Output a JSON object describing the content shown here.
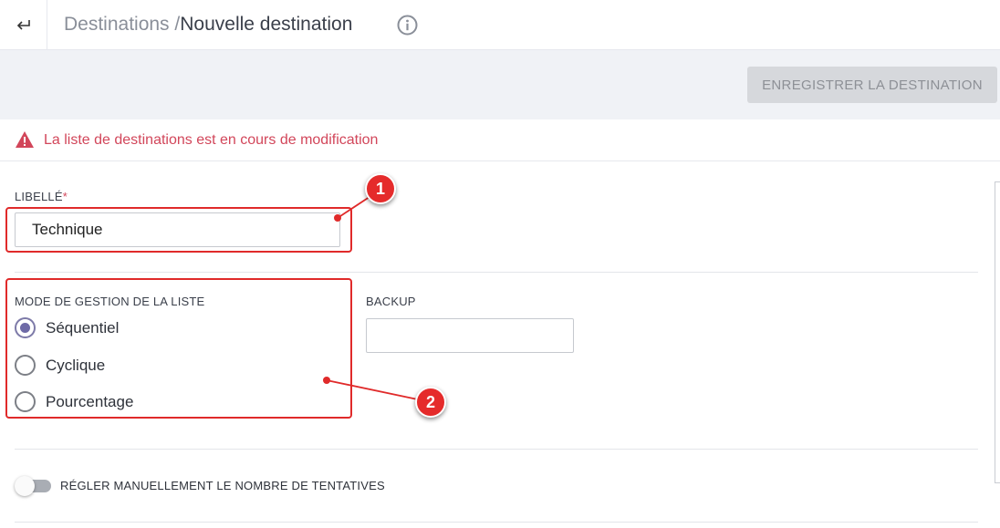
{
  "header": {
    "back_icon": "return-arrow-icon",
    "breadcrumb_parent": "Destinations",
    "breadcrumb_separator": "/",
    "breadcrumb_current": "Nouvelle destination",
    "info_icon": "info-circle-icon"
  },
  "toolbar": {
    "save_label": "ENREGISTRER LA DESTINATION",
    "save_disabled": true
  },
  "alert": {
    "icon": "warning-triangle-icon",
    "message": "La liste de destinations est en cours de modification",
    "color": "#d2465a"
  },
  "form": {
    "libelle": {
      "label": "LIBELLÉ",
      "required_mark": "*",
      "value": "Technique"
    },
    "mode": {
      "label": "MODE DE GESTION DE LA LISTE",
      "options": [
        {
          "label": "Séquentiel",
          "checked": true
        },
        {
          "label": "Cyclique",
          "checked": false
        },
        {
          "label": "Pourcentage",
          "checked": false
        }
      ]
    },
    "backup": {
      "label": "BACKUP",
      "value": ""
    },
    "manual_attempts": {
      "label": "RÉGLER MANUELLEMENT LE NOMBRE DE TENTATIVES",
      "enabled": false
    }
  },
  "annotations": {
    "badge_1": "1",
    "badge_2": "2",
    "color": "#e02a2a"
  }
}
